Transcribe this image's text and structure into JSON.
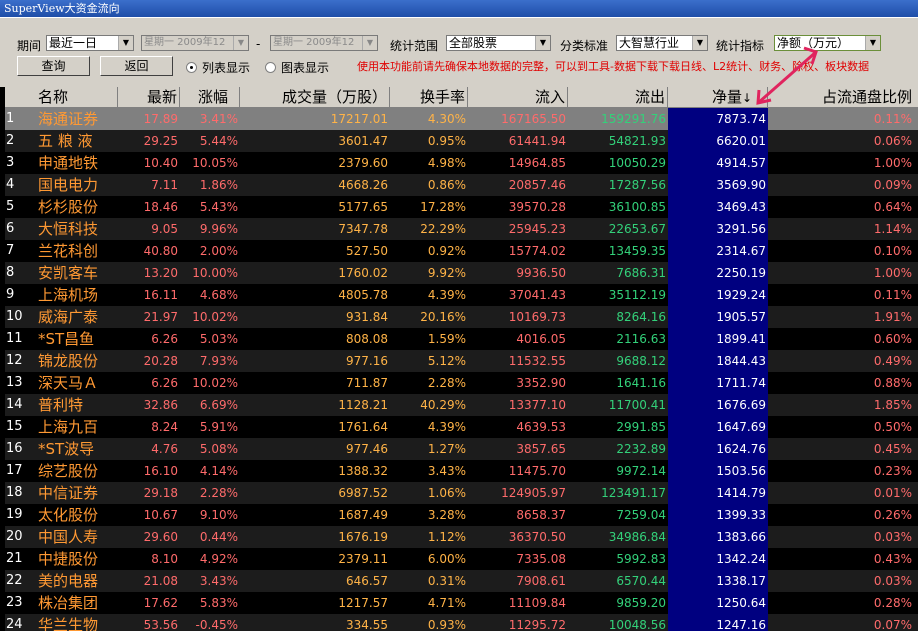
{
  "window": {
    "title": "SuperView大资金流向"
  },
  "toolbar": {
    "period_label": "期间",
    "period_value": "最近一日",
    "date_from": "星期一 2009年12",
    "date_sep": "-",
    "date_to": "星期一 2009年12",
    "scope_label": "统计范围",
    "scope_value": "全部股票",
    "category_label": "分类标准",
    "category_value": "大智慧行业",
    "metric_label": "统计指标",
    "metric_value": "净额（万元）",
    "query_button": "查询",
    "back_button": "返回",
    "list_view": "列表显示",
    "chart_view": "图表显示",
    "notice": "使用本功能前请先确保本地数据的完整，可以到工具-数据下载下载日线、L2统计、财务、除权、板块数据"
  },
  "table": {
    "columns": [
      "名称",
      "最新",
      "涨幅",
      "成交量（万股）",
      "换手率",
      "流入",
      "流出",
      "净量",
      "占流通盘比例"
    ],
    "rows": [
      {
        "idx": "1",
        "name": "海通证券",
        "price": "17.89",
        "change": "3.41%",
        "volume": "17217.01",
        "turnover": "4.30%",
        "inflow": "167165.50",
        "outflow": "159291.76",
        "net": "7873.74",
        "ratio": "0.11%"
      },
      {
        "idx": "2",
        "name": "五 粮 液",
        "price": "29.25",
        "change": "5.44%",
        "volume": "3601.47",
        "turnover": "0.95%",
        "inflow": "61441.94",
        "outflow": "54821.93",
        "net": "6620.01",
        "ratio": "0.06%"
      },
      {
        "idx": "3",
        "name": "申通地铁",
        "price": "10.40",
        "change": "10.05%",
        "volume": "2379.60",
        "turnover": "4.98%",
        "inflow": "14964.85",
        "outflow": "10050.29",
        "net": "4914.57",
        "ratio": "1.00%"
      },
      {
        "idx": "4",
        "name": "国电电力",
        "price": "7.11",
        "change": "1.86%",
        "volume": "4668.26",
        "turnover": "0.86%",
        "inflow": "20857.46",
        "outflow": "17287.56",
        "net": "3569.90",
        "ratio": "0.09%"
      },
      {
        "idx": "5",
        "name": "杉杉股份",
        "price": "18.46",
        "change": "5.43%",
        "volume": "5177.65",
        "turnover": "17.28%",
        "inflow": "39570.28",
        "outflow": "36100.85",
        "net": "3469.43",
        "ratio": "0.64%"
      },
      {
        "idx": "6",
        "name": "大恒科技",
        "price": "9.05",
        "change": "9.96%",
        "volume": "7347.78",
        "turnover": "22.29%",
        "inflow": "25945.23",
        "outflow": "22653.67",
        "net": "3291.56",
        "ratio": "1.14%"
      },
      {
        "idx": "7",
        "name": "兰花科创",
        "price": "40.80",
        "change": "2.00%",
        "volume": "527.50",
        "turnover": "0.92%",
        "inflow": "15774.02",
        "outflow": "13459.35",
        "net": "2314.67",
        "ratio": "0.10%"
      },
      {
        "idx": "8",
        "name": "安凯客车",
        "price": "13.20",
        "change": "10.00%",
        "volume": "1760.02",
        "turnover": "9.92%",
        "inflow": "9936.50",
        "outflow": "7686.31",
        "net": "2250.19",
        "ratio": "1.00%"
      },
      {
        "idx": "9",
        "name": "上海机场",
        "price": "16.11",
        "change": "4.68%",
        "volume": "4805.78",
        "turnover": "4.39%",
        "inflow": "37041.43",
        "outflow": "35112.19",
        "net": "1929.24",
        "ratio": "0.11%"
      },
      {
        "idx": "10",
        "name": "威海广泰",
        "price": "21.97",
        "change": "10.02%",
        "volume": "931.84",
        "turnover": "20.16%",
        "inflow": "10169.73",
        "outflow": "8264.16",
        "net": "1905.57",
        "ratio": "1.91%"
      },
      {
        "idx": "11",
        "name": "*ST昌鱼",
        "price": "6.26",
        "change": "5.03%",
        "volume": "808.08",
        "turnover": "1.59%",
        "inflow": "4016.05",
        "outflow": "2116.63",
        "net": "1899.41",
        "ratio": "0.60%"
      },
      {
        "idx": "12",
        "name": "锦龙股份",
        "price": "20.28",
        "change": "7.93%",
        "volume": "977.16",
        "turnover": "5.12%",
        "inflow": "11532.55",
        "outflow": "9688.12",
        "net": "1844.43",
        "ratio": "0.49%"
      },
      {
        "idx": "13",
        "name": "深天马Ａ",
        "price": "6.26",
        "change": "10.02%",
        "volume": "711.87",
        "turnover": "2.28%",
        "inflow": "3352.90",
        "outflow": "1641.16",
        "net": "1711.74",
        "ratio": "0.88%"
      },
      {
        "idx": "14",
        "name": "普利特",
        "price": "32.86",
        "change": "6.69%",
        "volume": "1128.21",
        "turnover": "40.29%",
        "inflow": "13377.10",
        "outflow": "11700.41",
        "net": "1676.69",
        "ratio": "1.85%"
      },
      {
        "idx": "15",
        "name": "上海九百",
        "price": "8.24",
        "change": "5.91%",
        "volume": "1761.64",
        "turnover": "4.39%",
        "inflow": "4639.53",
        "outflow": "2991.85",
        "net": "1647.69",
        "ratio": "0.50%"
      },
      {
        "idx": "16",
        "name": "*ST波导",
        "price": "4.76",
        "change": "5.08%",
        "volume": "977.46",
        "turnover": "1.27%",
        "inflow": "3857.65",
        "outflow": "2232.89",
        "net": "1624.76",
        "ratio": "0.45%"
      },
      {
        "idx": "17",
        "name": "综艺股份",
        "price": "16.10",
        "change": "4.14%",
        "volume": "1388.32",
        "turnover": "3.43%",
        "inflow": "11475.70",
        "outflow": "9972.14",
        "net": "1503.56",
        "ratio": "0.23%"
      },
      {
        "idx": "18",
        "name": "中信证券",
        "price": "29.18",
        "change": "2.28%",
        "volume": "6987.52",
        "turnover": "1.06%",
        "inflow": "124905.97",
        "outflow": "123491.17",
        "net": "1414.79",
        "ratio": "0.01%"
      },
      {
        "idx": "19",
        "name": "太化股份",
        "price": "10.67",
        "change": "9.10%",
        "volume": "1687.49",
        "turnover": "3.28%",
        "inflow": "8658.37",
        "outflow": "7259.04",
        "net": "1399.33",
        "ratio": "0.26%"
      },
      {
        "idx": "20",
        "name": "中国人寿",
        "price": "29.60",
        "change": "0.44%",
        "volume": "1676.19",
        "turnover": "1.12%",
        "inflow": "36370.50",
        "outflow": "34986.84",
        "net": "1383.66",
        "ratio": "0.03%"
      },
      {
        "idx": "21",
        "name": "中捷股份",
        "price": "8.10",
        "change": "4.92%",
        "volume": "2379.11",
        "turnover": "6.00%",
        "inflow": "7335.08",
        "outflow": "5992.83",
        "net": "1342.24",
        "ratio": "0.43%"
      },
      {
        "idx": "22",
        "name": "美的电器",
        "price": "21.08",
        "change": "3.43%",
        "volume": "646.57",
        "turnover": "0.31%",
        "inflow": "7908.61",
        "outflow": "6570.44",
        "net": "1338.17",
        "ratio": "0.03%"
      },
      {
        "idx": "23",
        "name": "株冶集团",
        "price": "17.62",
        "change": "5.83%",
        "volume": "1217.57",
        "turnover": "4.71%",
        "inflow": "11109.84",
        "outflow": "9859.20",
        "net": "1250.64",
        "ratio": "0.28%"
      },
      {
        "idx": "24",
        "name": "华兰生物",
        "price": "53.56",
        "change": "-0.45%",
        "volume": "334.55",
        "turnover": "0.93%",
        "inflow": "11295.72",
        "outflow": "10048.56",
        "net": "1247.16",
        "ratio": "0.07%"
      }
    ]
  },
  "colors": {
    "header_bg": "#d4d0c8",
    "selected_row": "#808080",
    "net_column": "#000080",
    "name_text": "#ff9933",
    "outflow_text": "#33d17a",
    "annotation": "#e0245e"
  }
}
